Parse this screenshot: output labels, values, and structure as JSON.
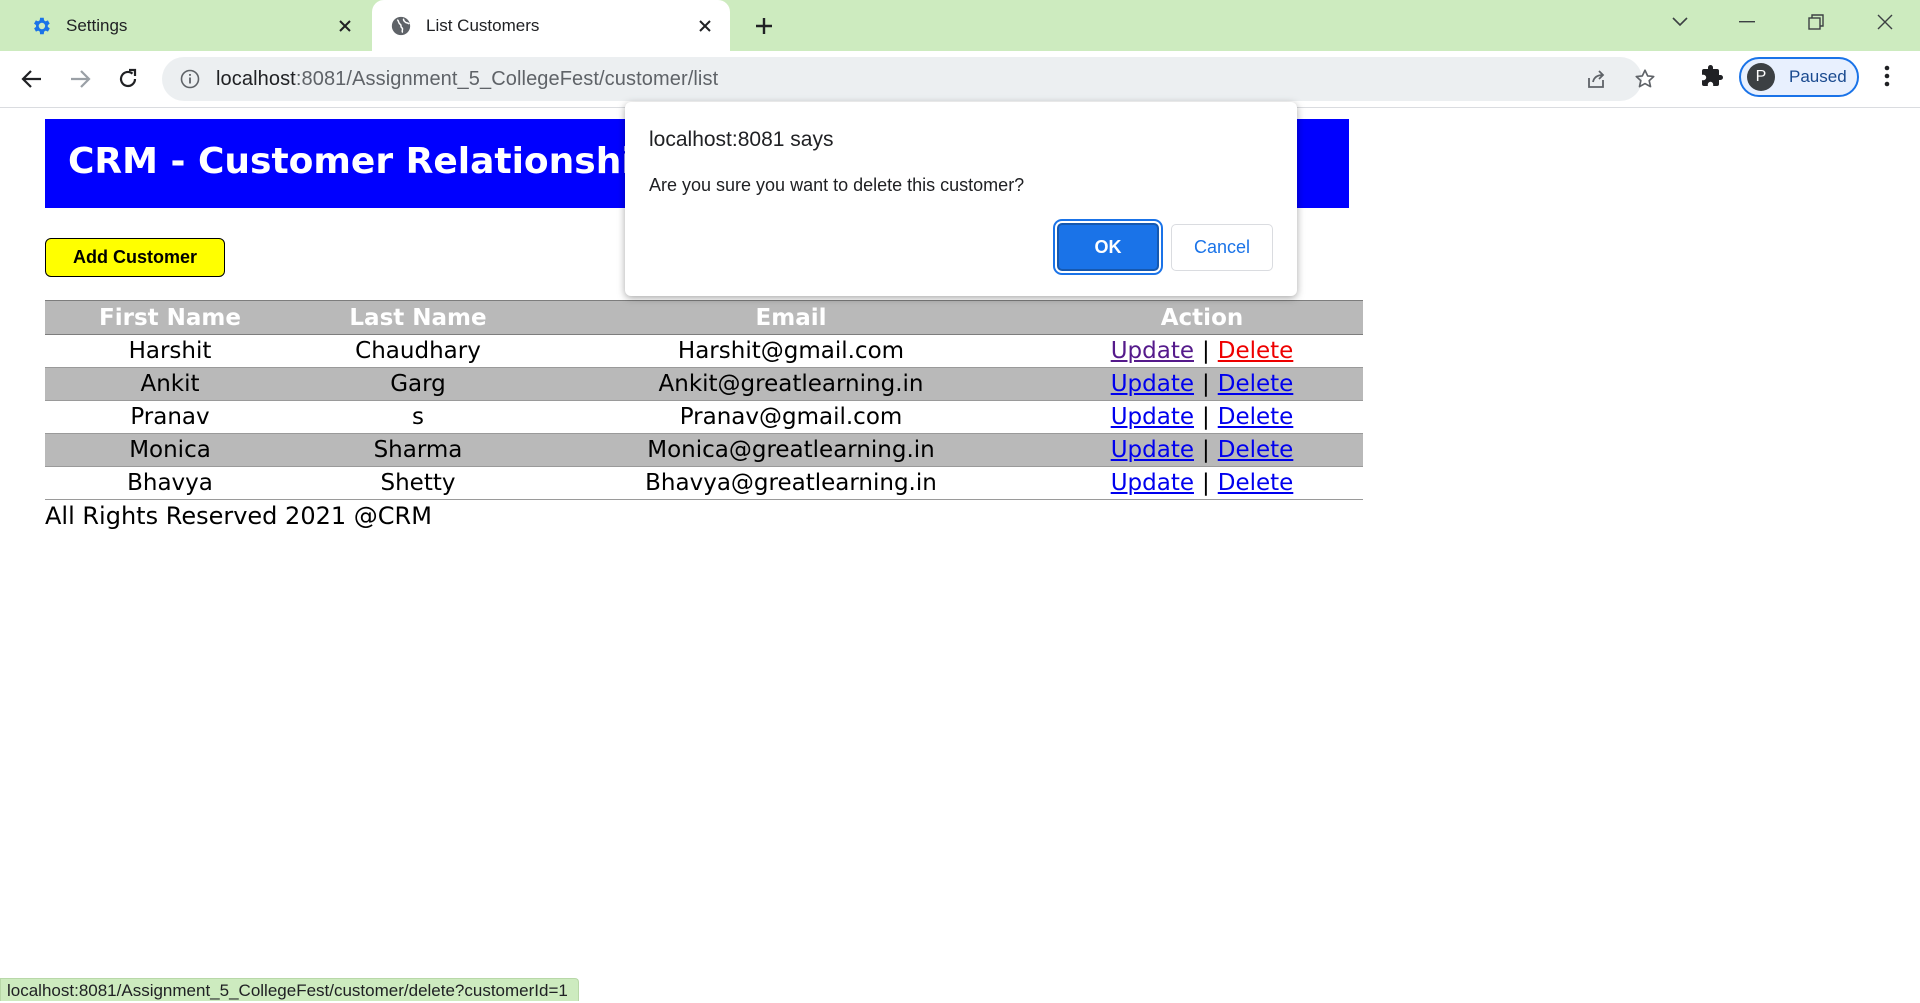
{
  "browser": {
    "tabs": [
      {
        "title": "Settings",
        "icon": "gear-icon"
      },
      {
        "title": "List Customers",
        "icon": "globe-icon",
        "active": true
      }
    ],
    "omnibox": {
      "host": "localhost",
      "rest": ":8081/Assignment_5_CollegeFest/customer/list"
    },
    "profile": {
      "initial": "P",
      "label": "Paused"
    },
    "status_url": "localhost:8081/Assignment_5_CollegeFest/customer/delete?customerId=1"
  },
  "page": {
    "header": "CRM - Customer Relationship Manager",
    "add_button": "Add Customer",
    "table": {
      "columns": [
        "First Name",
        "Last Name",
        "Email",
        "Action"
      ],
      "rows": [
        {
          "first": "Harshit",
          "last": "Chaudhary",
          "email": "Harshit@gmail.com"
        },
        {
          "first": "Ankit",
          "last": "Garg",
          "email": "Ankit@greatlearning.in"
        },
        {
          "first": "Pranav",
          "last": "s",
          "email": "Pranav@gmail.com"
        },
        {
          "first": "Monica",
          "last": "Sharma",
          "email": "Monica@greatlearning.in"
        },
        {
          "first": "Bhavya",
          "last": "Shetty",
          "email": "Bhavya@greatlearning.in"
        }
      ],
      "update_label": "Update",
      "delete_label": "Delete",
      "separator": "|"
    },
    "footer": "All Rights Reserved 2021 @CRM"
  },
  "dialog": {
    "title": "localhost:8081 says",
    "message": "Are you sure you want to delete this customer?",
    "ok_label": "OK",
    "cancel_label": "Cancel"
  },
  "colors": {
    "tabstrip": "#cdebbf",
    "header_bg": "#0000ff",
    "add_button_bg": "#ffff00",
    "row_alt_bg": "#b9b9b9",
    "ok_button_bg": "#1a73e8",
    "link": "#0000ee",
    "link_active": "#ee0000"
  }
}
